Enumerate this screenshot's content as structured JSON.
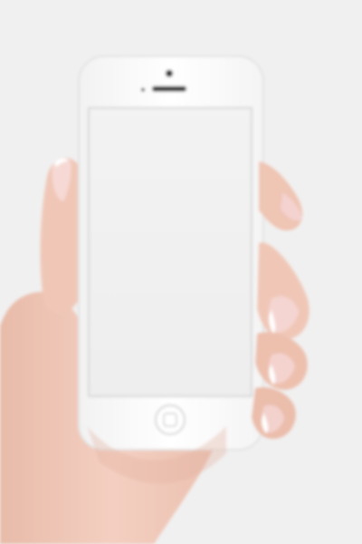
{
  "scene": {
    "subject": "hand-holding-white-smartphone",
    "screen_state": "blank"
  },
  "colors": {
    "background": "#f0f0f0",
    "phone_body": "#ffffff",
    "phone_edge": "#e4e4e4",
    "screen": "#f2f2f2",
    "screen_border": "#d8d8d8",
    "skin": "#f2cbbd",
    "skin_shadow": "#e2b3a1",
    "nail": "#f6d7d4",
    "nail_tip": "#ffffff"
  },
  "icons": {
    "camera": "front-camera-icon",
    "speaker": "earpiece-speaker-icon",
    "home": "home-button-icon"
  }
}
